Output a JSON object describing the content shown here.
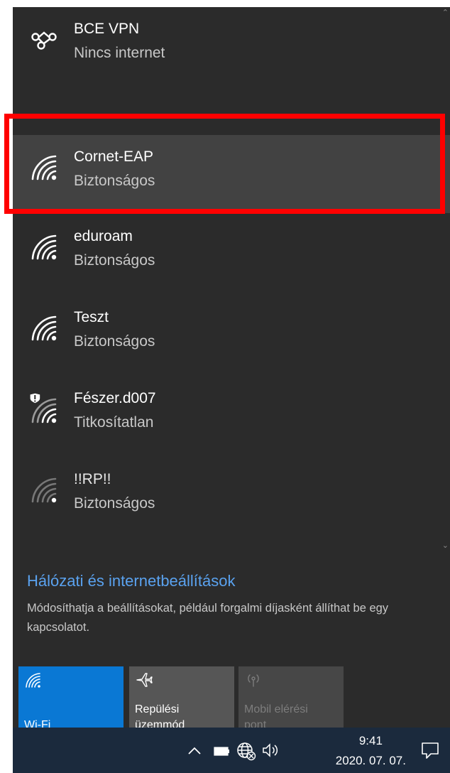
{
  "networks": [
    {
      "name": "BCE VPN",
      "status": "Nincs internet",
      "icon": "vpn-icon",
      "selected": false
    },
    {
      "name": "Cornet-EAP",
      "status": "Biztonságos",
      "icon": "wifi-icon",
      "selected": true
    },
    {
      "name": "eduroam",
      "status": "Biztonságos",
      "icon": "wifi-icon",
      "selected": false
    },
    {
      "name": "Teszt",
      "status": "Biztonságos",
      "icon": "wifi-icon",
      "selected": false
    },
    {
      "name": "Fészer.d007",
      "status": "Titkosítatlan",
      "icon": "wifi-unsecured-icon",
      "selected": false
    },
    {
      "name": "!!RP!!",
      "status": "Biztonságos",
      "icon": "wifi-weak-icon",
      "selected": false
    }
  ],
  "settings": {
    "link": "Hálózati és internetbeállítások",
    "description": "Módosíthatja a beállításokat, például forgalmi díjasként állíthat be egy kapcsolatot."
  },
  "tiles": {
    "wifi": {
      "label": "Wi-Fi",
      "icon": "wifi-icon",
      "active": true
    },
    "airplane": {
      "label_line1": "Repülési",
      "label_line2": "üzemmód",
      "icon": "airplane-icon",
      "active": false
    },
    "mobile_hotspot": {
      "label_line1": "Mobil elérési",
      "label_line2": "pont",
      "icon": "hotspot-icon",
      "active": false,
      "disabled": true
    }
  },
  "taskbar": {
    "time": "9:41",
    "date": "2020. 07. 07.",
    "icons": [
      "chevron-up-icon",
      "battery-icon",
      "globe-network-icon",
      "volume-icon",
      "action-center-icon"
    ]
  },
  "colors": {
    "flyout_bg": "#2b2b2b",
    "selected_bg": "#424242",
    "accent": "#0a78d4",
    "link": "#5aa2ef",
    "highlight": "#ff0000",
    "taskbar_bg": "#1b2a3d"
  }
}
